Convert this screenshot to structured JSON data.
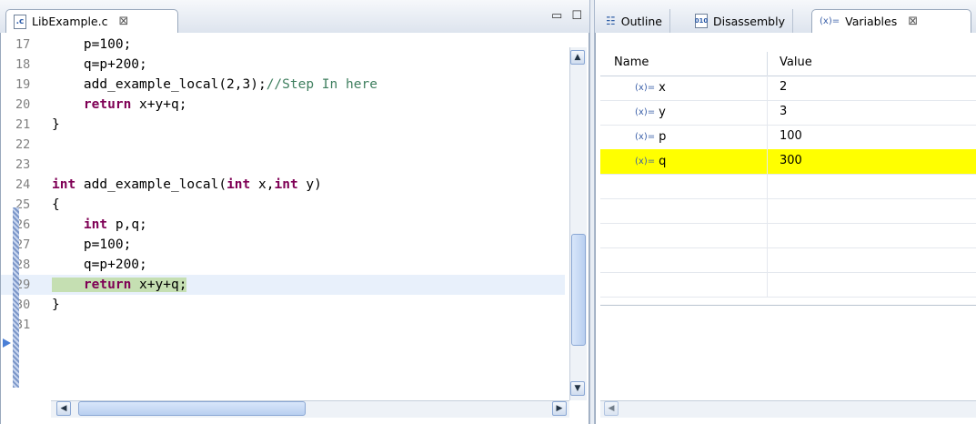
{
  "editor": {
    "tab_label": "LibExample.c",
    "tab_icon": "c-source-file-icon",
    "close_glyph": "⊠",
    "lines": [
      {
        "num": "17",
        "parts": [
          {
            "t": "    p=100;",
            "s": "pl"
          }
        ]
      },
      {
        "num": "18",
        "parts": [
          {
            "t": "    q=p+200;",
            "s": "pl"
          }
        ]
      },
      {
        "num": "19",
        "parts": [
          {
            "t": "    add_example_local(2,3);",
            "s": "pl"
          },
          {
            "t": "//Step In here",
            "s": "cm"
          }
        ]
      },
      {
        "num": "20",
        "parts": [
          {
            "t": "    ",
            "s": "pl"
          },
          {
            "t": "return",
            "s": "kw"
          },
          {
            "t": " x+y+q;",
            "s": "pl"
          }
        ]
      },
      {
        "num": "21",
        "parts": [
          {
            "t": "}",
            "s": "pl"
          }
        ]
      },
      {
        "num": "22",
        "parts": []
      },
      {
        "num": "23",
        "parts": []
      },
      {
        "num": "24",
        "parts": [
          {
            "t": "int",
            "s": "kw"
          },
          {
            "t": " add_example_local(",
            "s": "pl"
          },
          {
            "t": "int",
            "s": "kw"
          },
          {
            "t": " x,",
            "s": "pl"
          },
          {
            "t": "int",
            "s": "kw"
          },
          {
            "t": " y)",
            "s": "pl"
          }
        ]
      },
      {
        "num": "25",
        "parts": [
          {
            "t": "{",
            "s": "pl"
          }
        ]
      },
      {
        "num": "26",
        "parts": [
          {
            "t": "    ",
            "s": "pl"
          },
          {
            "t": "int",
            "s": "kw"
          },
          {
            "t": " p,q;",
            "s": "pl"
          }
        ]
      },
      {
        "num": "27",
        "parts": [
          {
            "t": "    p=100;",
            "s": "pl"
          }
        ]
      },
      {
        "num": "28",
        "parts": [
          {
            "t": "    q=p+200;",
            "s": "pl"
          }
        ]
      },
      {
        "num": "29",
        "current": true,
        "parts": [
          {
            "t": "    ",
            "s": "pl"
          },
          {
            "t": "return",
            "s": "kw"
          },
          {
            "t": " x+y+q;",
            "s": "pl"
          }
        ]
      },
      {
        "num": "30",
        "parts": [
          {
            "t": "}",
            "s": "pl"
          }
        ]
      },
      {
        "num": "31",
        "parts": []
      }
    ]
  },
  "right_tabs": [
    {
      "label": "Outline",
      "icon": "outline-icon"
    },
    {
      "label": "Disassembly",
      "icon": "disassembly-icon"
    },
    {
      "label": "Variables",
      "icon": "variables-icon",
      "prefix": "(x)=",
      "active": true
    }
  ],
  "variables": {
    "columns": [
      "Name",
      "Value"
    ],
    "rows": [
      {
        "name": "x",
        "value": "2"
      },
      {
        "name": "y",
        "value": "3"
      },
      {
        "name": "p",
        "value": "100"
      },
      {
        "name": "q",
        "value": "300",
        "changed": true
      }
    ],
    "row_icon_text": "(x)=",
    "changed_color": "#ffff00"
  },
  "colors": {
    "keyword": "#7f0055",
    "comment": "#3f7f5f",
    "current_line_bg": "#c5dfb2"
  }
}
